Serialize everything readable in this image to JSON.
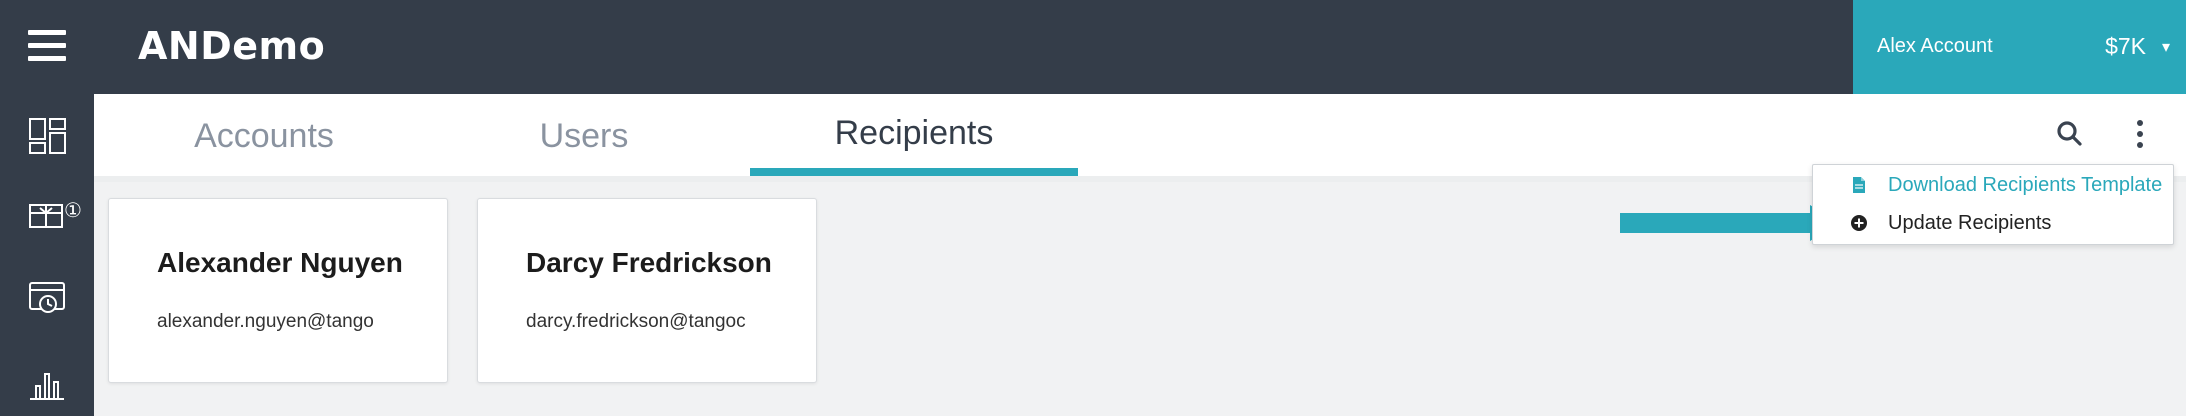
{
  "app": {
    "brand": "ANDemo"
  },
  "account": {
    "name": "Alex Account",
    "balance": "$7K",
    "caret": "▾"
  },
  "sidebar": {
    "badge": "①",
    "items": [
      {
        "icon": "dashboard-icon"
      },
      {
        "icon": "gift-card-icon"
      },
      {
        "icon": "scheduled-orders-icon"
      },
      {
        "icon": "reports-bar-chart-icon"
      }
    ]
  },
  "tabs": [
    {
      "label": "Accounts",
      "active": false
    },
    {
      "label": "Users",
      "active": false
    },
    {
      "label": "Recipients",
      "active": true
    }
  ],
  "toolbar": {
    "search_icon": "search-icon",
    "more_icon": "more-vertical-icon"
  },
  "menu": {
    "download_label": "Download Recipients Template",
    "update_label": "Update Recipients"
  },
  "recipients": [
    {
      "name": "Alexander Nguyen",
      "email": "alexander.nguyen@tango"
    },
    {
      "name": "Darcy Fredrickson",
      "email": "darcy.fredrickson@tangoc"
    }
  ],
  "colors": {
    "nav_bg": "#343d49",
    "accent": "#2aa8ba",
    "content_bg": "#f1f2f3"
  }
}
